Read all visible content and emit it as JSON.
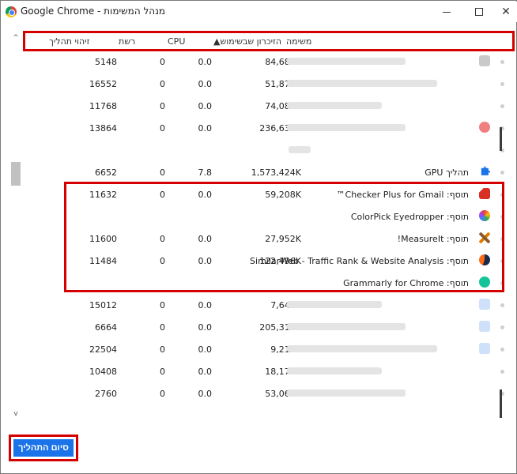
{
  "window": {
    "title": "Google Chrome - מנהל המשימות"
  },
  "columns": {
    "task": "משימה",
    "memory": "▲הזיכרון שבשימוש",
    "cpu": "CPU",
    "network": "רשת",
    "pid": "זיהוי תהליך"
  },
  "rows": [
    {
      "pid": "5148",
      "net": "0",
      "cpu": "0.0",
      "mem": "84,680K",
      "task": "",
      "icon": "gray-favicon"
    },
    {
      "pid": "16552",
      "net": "0",
      "cpu": "0.0",
      "mem": "51,872K",
      "task": "",
      "icon": "none"
    },
    {
      "pid": "11768",
      "net": "0",
      "cpu": "0.0",
      "mem": "74,080K",
      "task": "",
      "icon": "none"
    },
    {
      "pid": "13864",
      "net": "0",
      "cpu": "0.0",
      "mem": "236,632K",
      "task": "",
      "icon": "red-favicon"
    },
    {
      "pid": "",
      "net": "",
      "cpu": "",
      "mem": "",
      "task": "",
      "icon": "none"
    },
    {
      "pid": "6652",
      "net": "0",
      "cpu": "7.8",
      "mem": "1,573,424K",
      "task": "תהליך GPU",
      "icon": "puzzle-icon"
    },
    {
      "pid": "11632",
      "net": "0",
      "cpu": "0.0",
      "mem": "59,208K",
      "task": "תוסף: Checker Plus for Gmail™",
      "icon": "gmail-checker-icon"
    },
    {
      "pid": "",
      "net": "",
      "cpu": "",
      "mem": "",
      "task": "תוסף: ColorPick Eyedropper",
      "icon": "colorpick-icon"
    },
    {
      "pid": "11600",
      "net": "0",
      "cpu": "0.0",
      "mem": "27,952K",
      "task": "תוסף: MeasureIt!",
      "icon": "measureit-icon"
    },
    {
      "pid": "11484",
      "net": "0",
      "cpu": "0.0",
      "mem": "122,496K",
      "task": "תוסף: SimilarWeb - Traffic Rank & Website Analysis",
      "icon": "similarweb-icon"
    },
    {
      "pid": "",
      "net": "",
      "cpu": "",
      "mem": "",
      "task": "תוסף: Grammarly for Chrome",
      "icon": "grammarly-icon"
    },
    {
      "pid": "15012",
      "net": "0",
      "cpu": "0.0",
      "mem": "7,644K",
      "task": "",
      "icon": "blue-favicon"
    },
    {
      "pid": "6664",
      "net": "0",
      "cpu": "0.0",
      "mem": "205,316K",
      "task": "",
      "icon": "blue-favicon"
    },
    {
      "pid": "22504",
      "net": "0",
      "cpu": "0.0",
      "mem": "9,216K",
      "task": "",
      "icon": "blue-favicon"
    },
    {
      "pid": "10408",
      "net": "0",
      "cpu": "0.0",
      "mem": "18,172K",
      "task": "",
      "icon": "none"
    },
    {
      "pid": "2760",
      "net": "0",
      "cpu": "0.0",
      "mem": "53,060K",
      "task": "",
      "icon": "none"
    }
  ],
  "end_process_button": "סיום התהליך",
  "colors": {
    "highlight": "#d40000",
    "button": "#1a73e8"
  }
}
